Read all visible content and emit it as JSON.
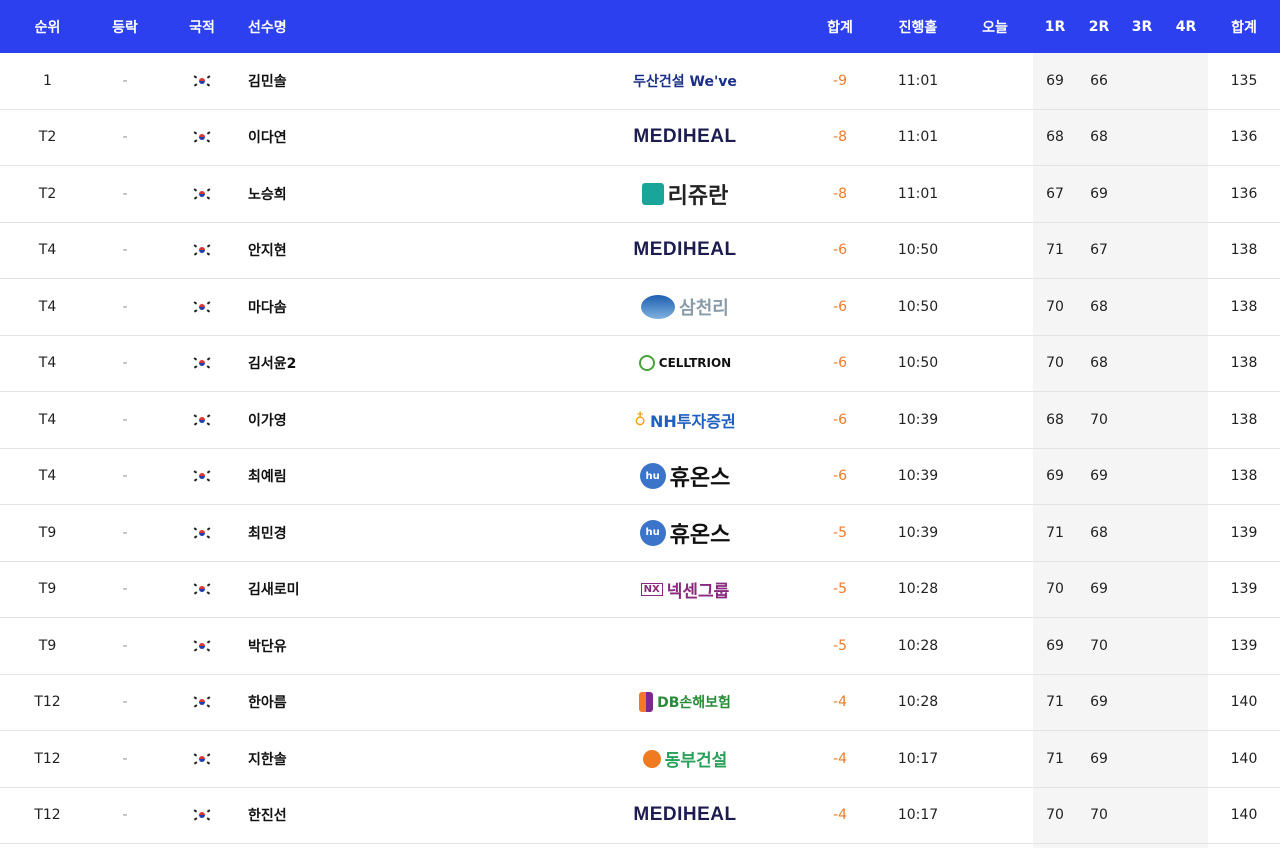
{
  "header": {
    "rank": "순위",
    "movement": "등락",
    "nation": "국적",
    "player": "선수명",
    "total": "합계",
    "hole": "진행홀",
    "today": "오늘",
    "r1": "1R",
    "r2": "2R",
    "r3": "3R",
    "r4": "4R",
    "sum": "합계"
  },
  "rows": [
    {
      "rank": "1",
      "move": "-",
      "name": "김민솔",
      "sponsor": "두산건설 We've",
      "sponsor_logo": "doosan",
      "total": "-9",
      "hole": "11:01",
      "today": "",
      "r1": "69",
      "r2": "66",
      "r3": "",
      "r4": "",
      "sum": "135"
    },
    {
      "rank": "T2",
      "move": "-",
      "name": "이다연",
      "sponsor": "MEDIHEAL",
      "sponsor_logo": "mediheal",
      "total": "-8",
      "hole": "11:01",
      "today": "",
      "r1": "68",
      "r2": "68",
      "r3": "",
      "r4": "",
      "sum": "136"
    },
    {
      "rank": "T2",
      "move": "-",
      "name": "노승희",
      "sponsor": "리쥬란",
      "sponsor_logo": "rijuran",
      "total": "-8",
      "hole": "11:01",
      "today": "",
      "r1": "67",
      "r2": "69",
      "r3": "",
      "r4": "",
      "sum": "136"
    },
    {
      "rank": "T4",
      "move": "-",
      "name": "안지현",
      "sponsor": "MEDIHEAL",
      "sponsor_logo": "mediheal",
      "total": "-6",
      "hole": "10:50",
      "today": "",
      "r1": "71",
      "r2": "67",
      "r3": "",
      "r4": "",
      "sum": "138"
    },
    {
      "rank": "T4",
      "move": "-",
      "name": "마다솜",
      "sponsor": "삼천리",
      "sponsor_logo": "samchully",
      "total": "-6",
      "hole": "10:50",
      "today": "",
      "r1": "70",
      "r2": "68",
      "r3": "",
      "r4": "",
      "sum": "138"
    },
    {
      "rank": "T4",
      "move": "-",
      "name": "김서윤2",
      "sponsor": "CELLTRION",
      "sponsor_logo": "celltrion",
      "total": "-6",
      "hole": "10:50",
      "today": "",
      "r1": "70",
      "r2": "68",
      "r3": "",
      "r4": "",
      "sum": "138"
    },
    {
      "rank": "T4",
      "move": "-",
      "name": "이가영",
      "sponsor": "NH투자증권",
      "sponsor_logo": "nh",
      "total": "-6",
      "hole": "10:39",
      "today": "",
      "r1": "68",
      "r2": "70",
      "r3": "",
      "r4": "",
      "sum": "138"
    },
    {
      "rank": "T4",
      "move": "-",
      "name": "최예림",
      "sponsor": "휴온스",
      "sponsor_logo": "huons",
      "total": "-6",
      "hole": "10:39",
      "today": "",
      "r1": "69",
      "r2": "69",
      "r3": "",
      "r4": "",
      "sum": "138"
    },
    {
      "rank": "T9",
      "move": "-",
      "name": "최민경",
      "sponsor": "휴온스",
      "sponsor_logo": "huons",
      "total": "-5",
      "hole": "10:39",
      "today": "",
      "r1": "71",
      "r2": "68",
      "r3": "",
      "r4": "",
      "sum": "139"
    },
    {
      "rank": "T9",
      "move": "-",
      "name": "김새로미",
      "sponsor": "넥센그룹",
      "sponsor_logo": "nexen",
      "total": "-5",
      "hole": "10:28",
      "today": "",
      "r1": "70",
      "r2": "69",
      "r3": "",
      "r4": "",
      "sum": "139"
    },
    {
      "rank": "T9",
      "move": "-",
      "name": "박단유",
      "sponsor": "",
      "sponsor_logo": "",
      "total": "-5",
      "hole": "10:28",
      "today": "",
      "r1": "69",
      "r2": "70",
      "r3": "",
      "r4": "",
      "sum": "139"
    },
    {
      "rank": "T12",
      "move": "-",
      "name": "한아름",
      "sponsor": "DB손해보험",
      "sponsor_logo": "db",
      "total": "-4",
      "hole": "10:28",
      "today": "",
      "r1": "71",
      "r2": "69",
      "r3": "",
      "r4": "",
      "sum": "140"
    },
    {
      "rank": "T12",
      "move": "-",
      "name": "지한솔",
      "sponsor": "동부건설",
      "sponsor_logo": "dongbu",
      "total": "-4",
      "hole": "10:17",
      "today": "",
      "r1": "71",
      "r2": "69",
      "r3": "",
      "r4": "",
      "sum": "140"
    },
    {
      "rank": "T12",
      "move": "-",
      "name": "한진선",
      "sponsor": "MEDIHEAL",
      "sponsor_logo": "mediheal",
      "total": "-4",
      "hole": "10:17",
      "today": "",
      "r1": "70",
      "r2": "70",
      "r3": "",
      "r4": "",
      "sum": "140"
    }
  ],
  "nation_icon": "korea-flag-icon",
  "colors": {
    "header_bg": "#2d40f0",
    "total_score": "#f07a2a"
  }
}
